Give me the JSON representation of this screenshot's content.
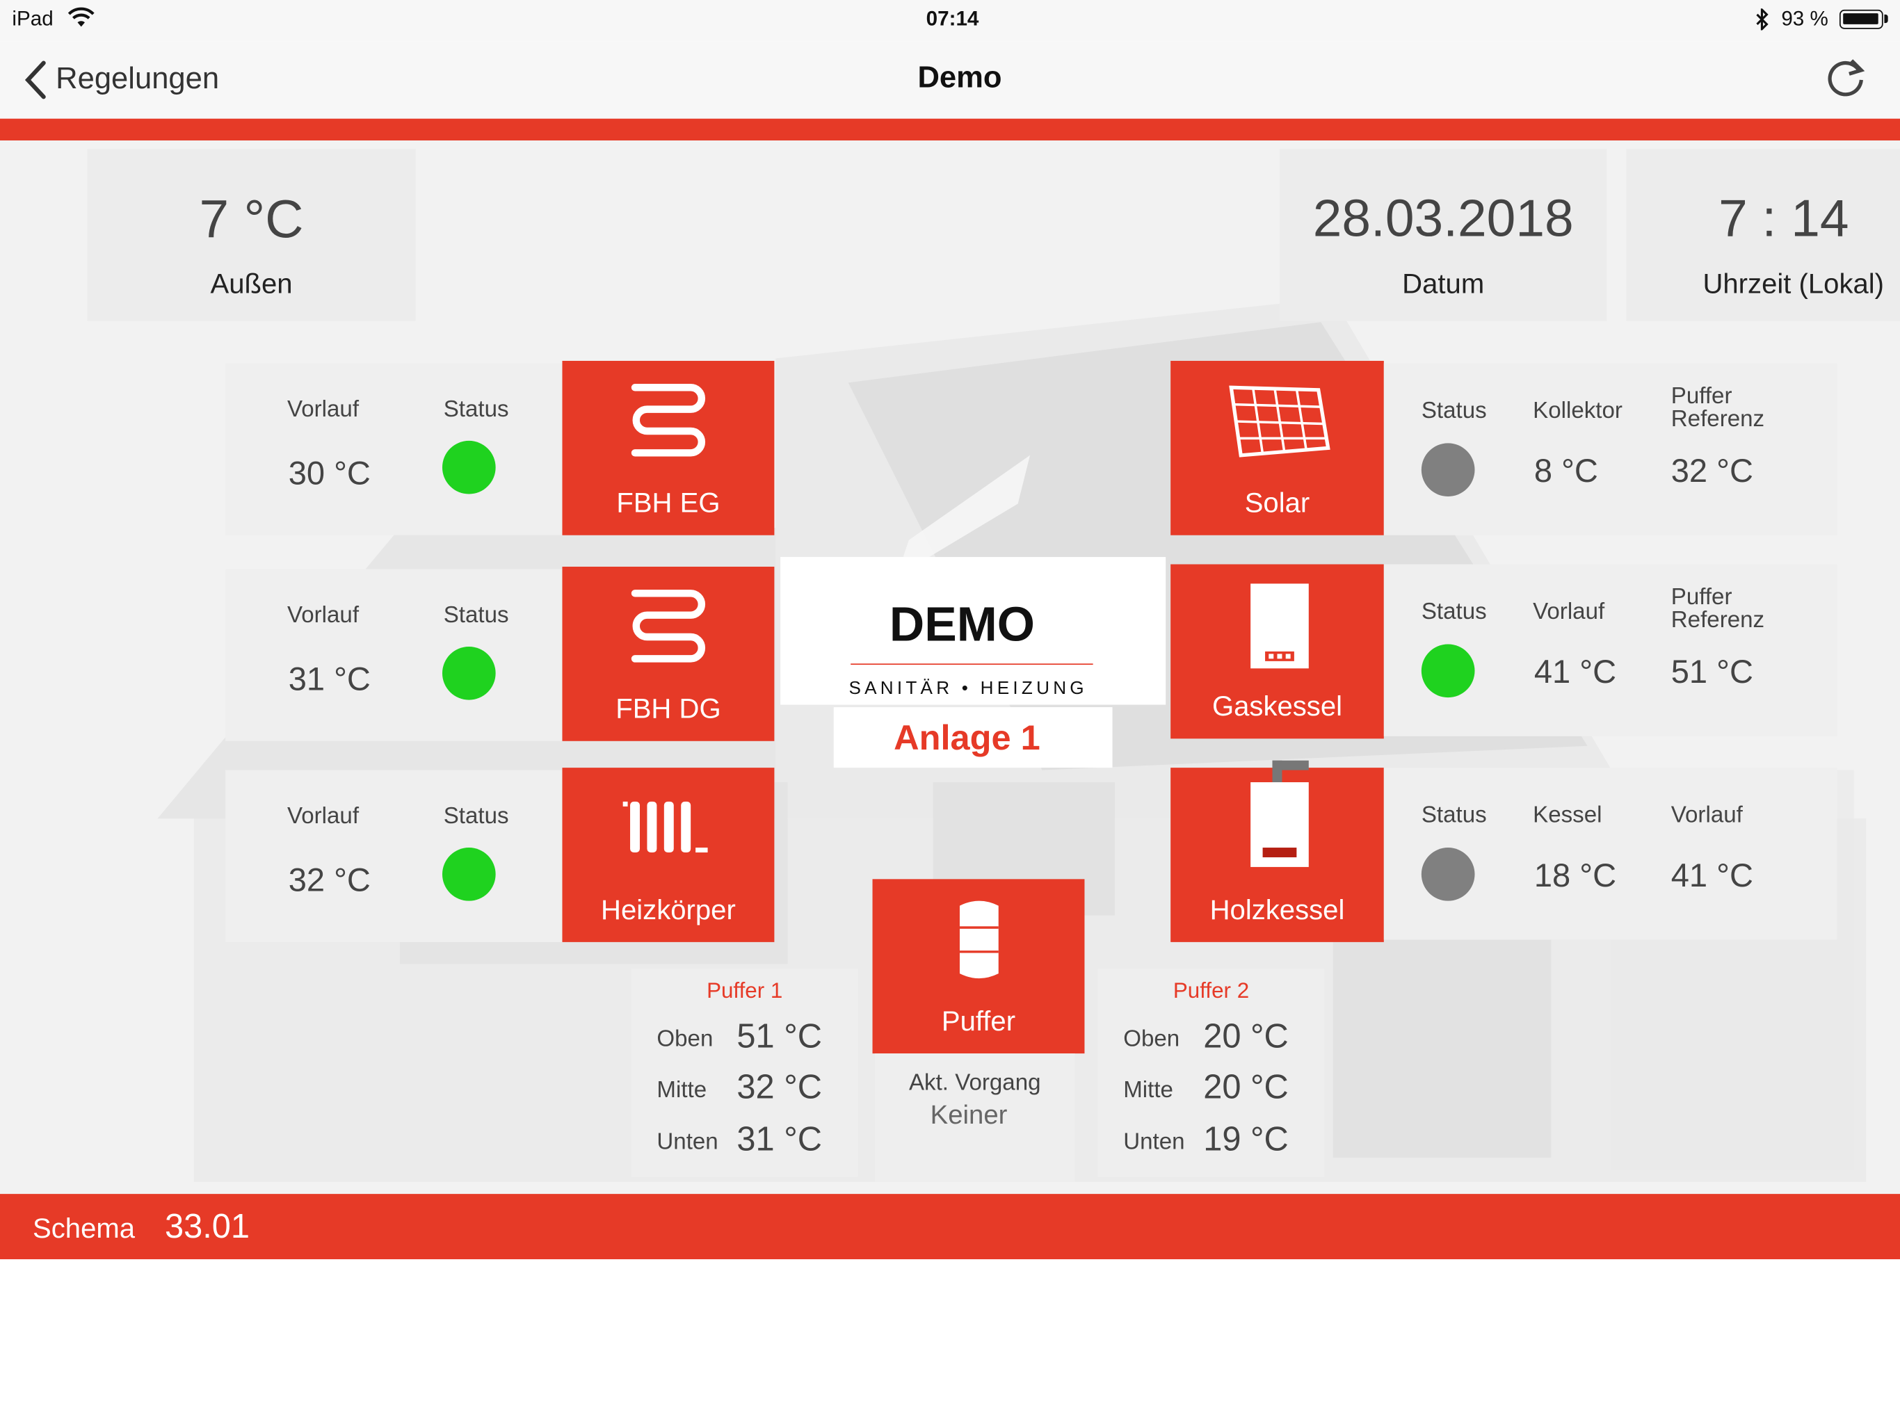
{
  "statusbar": {
    "device": "iPad",
    "time": "07:14",
    "battery": "93 %"
  },
  "nav": {
    "back_label": "Regelungen",
    "title": "Demo"
  },
  "outside": {
    "value": "7 °C",
    "label": "Außen"
  },
  "date": {
    "value": "28.03.2018",
    "label": "Datum"
  },
  "clock": {
    "value": "7 : 14",
    "label": "Uhrzeit (Lokal)"
  },
  "circuits": [
    {
      "name": "FBH EG",
      "col1_label": "Vorlauf",
      "col2_label": "Status",
      "vorlauf": "30 °C",
      "status_color": "#1fd21f"
    },
    {
      "name": "FBH DG",
      "col1_label": "Vorlauf",
      "col2_label": "Status",
      "vorlauf": "31 °C",
      "status_color": "#1fd21f"
    },
    {
      "name": "Heizkörper",
      "col1_label": "Vorlauf",
      "col2_label": "Status",
      "vorlauf": "32 °C",
      "status_color": "#1fd21f"
    }
  ],
  "sources": [
    {
      "name": "Solar",
      "status_label": "Status",
      "status_color": "#808080",
      "b_label": "Kollektor",
      "b_value": "8 °C",
      "c_label": "Puffer Referenz",
      "c_value": "32 °C"
    },
    {
      "name": "Gaskessel",
      "status_label": "Status",
      "status_color": "#1fd21f",
      "b_label": "Vorlauf",
      "b_value": "41 °C",
      "c_label": "Puffer Referenz",
      "c_value": "51 °C"
    },
    {
      "name": "Holzkessel",
      "status_label": "Status",
      "status_color": "#808080",
      "b_label": "Kessel",
      "b_value": "18 °C",
      "c_label": "Vorlauf",
      "c_value": "41 °C"
    }
  ],
  "logo": {
    "brand": "DEMO",
    "tagline": "SANITÄR • HEIZUNG",
    "plant": "Anlage 1"
  },
  "puffer": {
    "tile_label": "Puffer",
    "vorgang_label": "Akt. Vorgang",
    "vorgang_value": "Keiner",
    "p1": {
      "title": "Puffer 1",
      "oben_label": "Oben",
      "oben": "51 °C",
      "mitte_label": "Mitte",
      "mitte": "32 °C",
      "unten_label": "Unten",
      "unten": "31 °C"
    },
    "p2": {
      "title": "Puffer 2",
      "oben_label": "Oben",
      "oben": "20 °C",
      "mitte_label": "Mitte",
      "mitte": "20 °C",
      "unten_label": "Unten",
      "unten": "19 °C"
    }
  },
  "footer": {
    "label": "Schema",
    "value": "33.01"
  },
  "colors": {
    "accent": "#e63a27",
    "ok": "#1fd21f",
    "off": "#808080"
  },
  "icons": [
    "back-chevron-icon",
    "refresh-icon",
    "wifi-icon",
    "bluetooth-icon",
    "battery-icon",
    "floor-heating-icon",
    "radiator-icon",
    "solar-panel-icon",
    "gas-boiler-icon",
    "wood-boiler-icon",
    "buffer-tank-icon"
  ]
}
